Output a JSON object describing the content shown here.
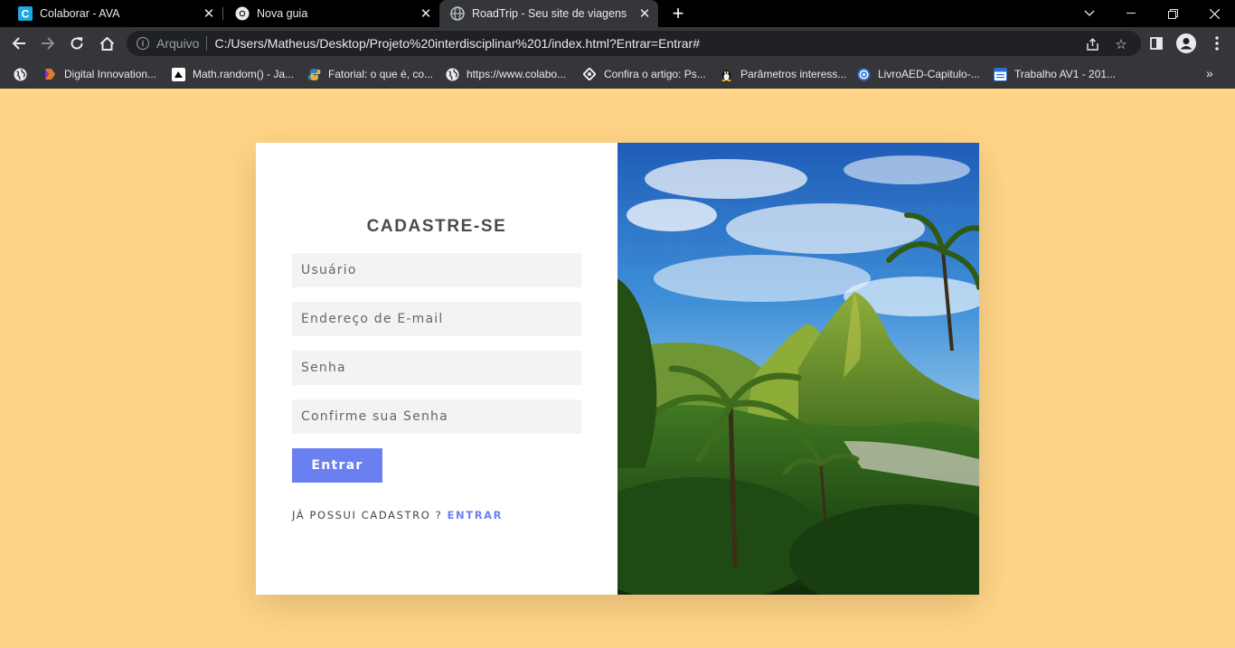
{
  "browser": {
    "tabs": [
      {
        "title": "Colaborar - AVA",
        "icon": "colaborar-favicon"
      },
      {
        "title": "Nova guia",
        "icon": "chrome-favicon"
      },
      {
        "title": "RoadTrip - Seu site de viagens",
        "icon": "globe-favicon",
        "active": true
      }
    ],
    "omnibox": {
      "scheme_label": "Arquivo",
      "url": "C:/Users/Matheus/Desktop/Projeto%20interdisciplinar%201/index.html?Entrar=Entrar#"
    },
    "bookmarks": [
      {
        "label": "Digital Innovation...",
        "icon": "dio-icon"
      },
      {
        "label": "Math.random() - Ja...",
        "icon": "math-random-icon"
      },
      {
        "label": "Fatorial: o que é, co...",
        "icon": "python-icon"
      },
      {
        "label": "https://www.colabo...",
        "icon": "globe-icon"
      },
      {
        "label": "Confira o artigo: Ps...",
        "icon": "diamond-icon"
      },
      {
        "label": "Parâmetros interess...",
        "icon": "linux-penguin-icon"
      },
      {
        "label": "LivroAED-Capitulo-...",
        "icon": "circle-logo-icon"
      },
      {
        "label": "Trabalho AV1 - 201...",
        "icon": "document-icon"
      }
    ]
  },
  "page": {
    "background": "#ffd486",
    "accent": "#6b80f0",
    "form": {
      "title": "CADASTRE-SE",
      "username_placeholder": "Usuário",
      "email_placeholder": "Endereço de E-mail",
      "password_placeholder": "Senha",
      "confirm_placeholder": "Confirme sua Senha",
      "submit_label": "Entrar",
      "already_text": "JÁ POSSUI CADASTRO ?",
      "login_link": "ENTRAR"
    },
    "image": {
      "subject": "tropical mountains and palm trees"
    }
  }
}
